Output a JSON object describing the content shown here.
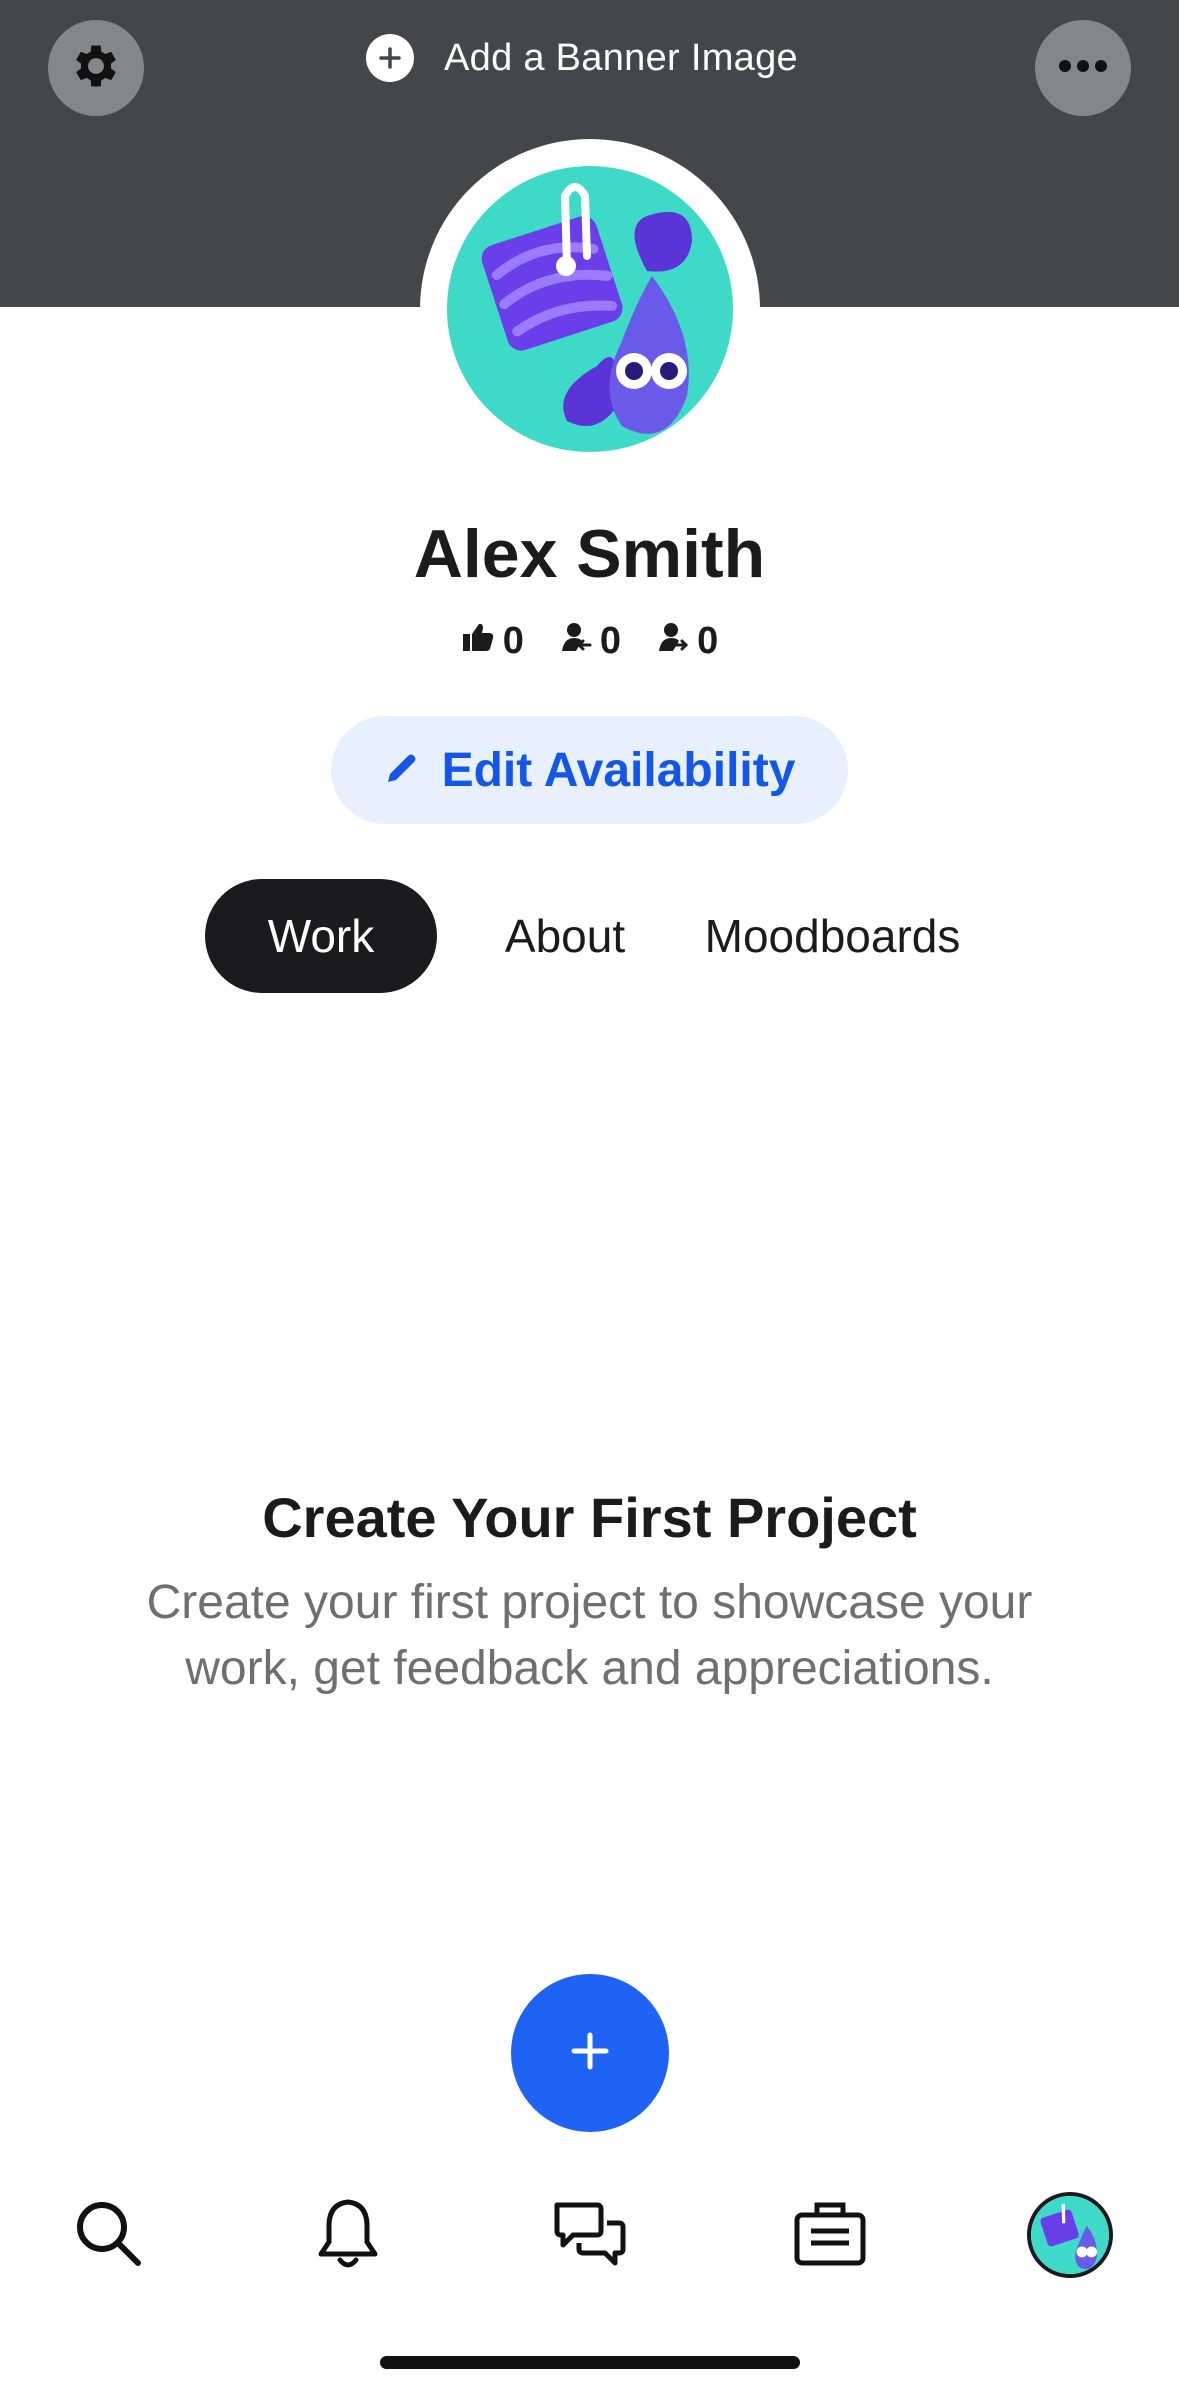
{
  "header": {
    "add_banner_label": "Add a Banner Image",
    "settings_icon": "gear-icon",
    "more_icon": "ellipsis-icon"
  },
  "profile": {
    "name": "Alex Smith",
    "stats": {
      "appreciations": "0",
      "followers": "0",
      "following": "0"
    },
    "edit_availability_label": "Edit Availability"
  },
  "tabs": [
    {
      "label": "Work",
      "active": true
    },
    {
      "label": "About",
      "active": false
    },
    {
      "label": "Moodboards",
      "active": false
    }
  ],
  "empty_state": {
    "title": "Create Your First Project",
    "description": "Create your first project to showcase your work, get feedback and appreciations."
  },
  "bottom_nav": {
    "items": [
      "search-icon",
      "bell-icon",
      "chat-icon",
      "briefcase-icon",
      "profile-avatar"
    ]
  },
  "colors": {
    "banner": "#45464a",
    "accent_blue": "#1f63f5",
    "edit_button_bg": "#e9f0fd",
    "edit_button_text": "#1457e6",
    "active_tab": "#1b1b1d",
    "avatar_bg": "#3fd9c8",
    "avatar_purple": "#6a3ee8"
  }
}
